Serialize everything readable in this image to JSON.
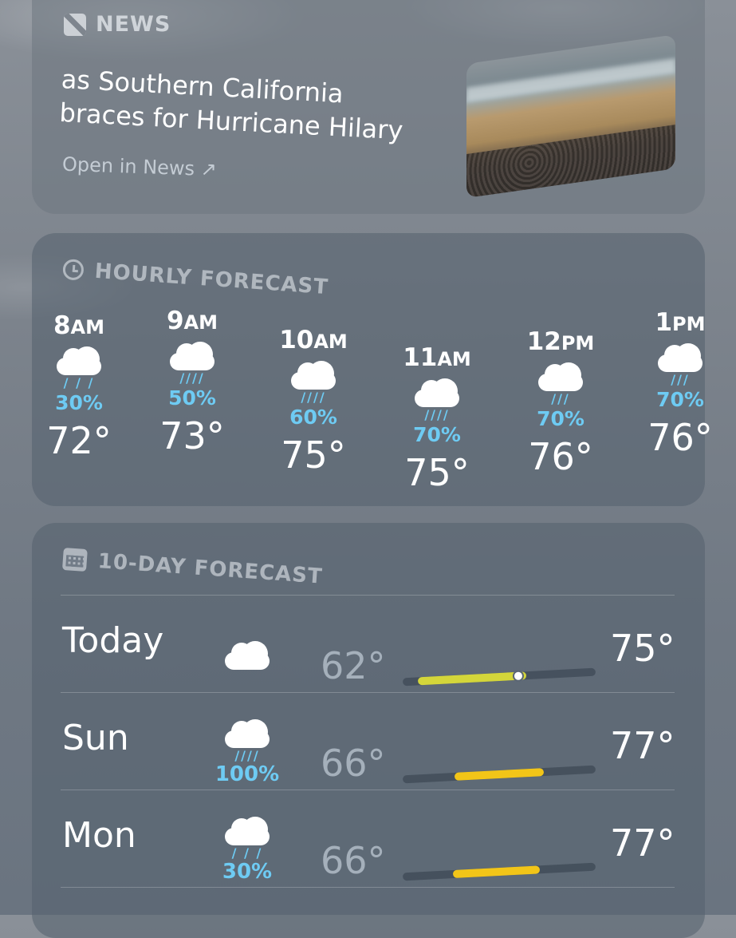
{
  "news": {
    "header": "NEWS",
    "headline": "as Southern California braces for Hurricane Hilary",
    "link": "Open in News ↗"
  },
  "hourly": {
    "header": "HOURLY FORECAST",
    "hours": [
      {
        "hour": "8",
        "ampm": "AM",
        "precip": "30%",
        "temp": "72°",
        "icon": "cloud-drizzle-icon"
      },
      {
        "hour": "9",
        "ampm": "AM",
        "precip": "50%",
        "temp": "73°",
        "icon": "cloud-rain-icon"
      },
      {
        "hour": "10",
        "ampm": "AM",
        "precip": "60%",
        "temp": "75°",
        "icon": "cloud-rain-icon"
      },
      {
        "hour": "11",
        "ampm": "AM",
        "precip": "70%",
        "temp": "75°",
        "icon": "cloud-heavy-rain-icon"
      },
      {
        "hour": "12",
        "ampm": "PM",
        "precip": "70%",
        "temp": "76°",
        "icon": "cloud-rain-icon"
      },
      {
        "hour": "1",
        "ampm": "PM",
        "precip": "70%",
        "temp": "76°",
        "icon": "cloud-rain-icon"
      }
    ]
  },
  "tenday": {
    "header": "10-DAY FORECAST",
    "days": [
      {
        "name": "Today",
        "precip": "",
        "low": "62°",
        "high": "75°",
        "icon": "cloud-icon",
        "fill_start": 0.08,
        "fill_end": 0.64,
        "current": 0.6,
        "fill_color": "#d4d63a"
      },
      {
        "name": "Sun",
        "precip": "100%",
        "low": "66°",
        "high": "77°",
        "icon": "cloud-heavy-rain-icon",
        "fill_start": 0.27,
        "fill_end": 0.73,
        "fill_color": "#f2c518"
      },
      {
        "name": "Mon",
        "precip": "30%",
        "low": "66°",
        "high": "77°",
        "icon": "cloud-drizzle-icon",
        "fill_start": 0.26,
        "fill_end": 0.71,
        "fill_color": "#f2c518"
      }
    ]
  }
}
